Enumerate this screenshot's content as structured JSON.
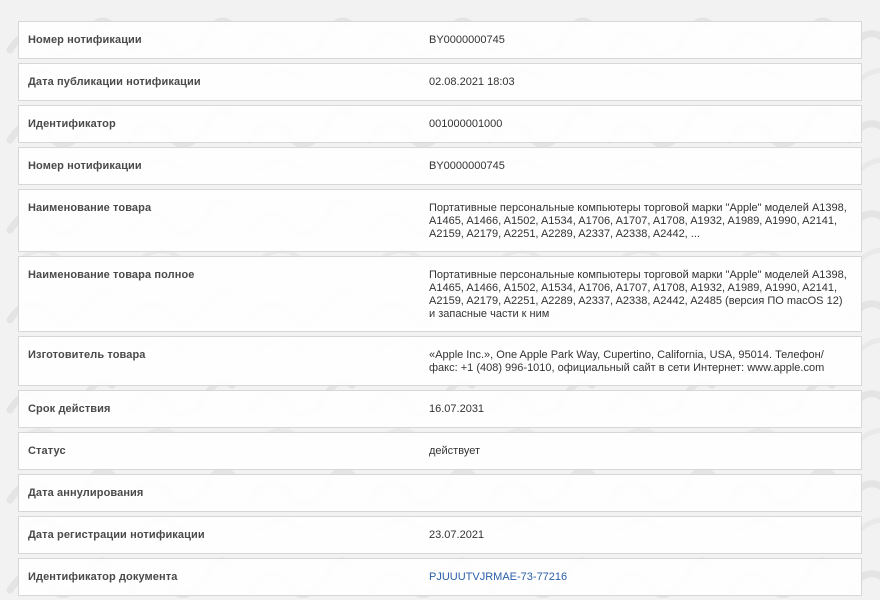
{
  "rows": [
    {
      "label": "Номер нотификации",
      "value": "BY0000000745"
    },
    {
      "label": "Дата публикации нотификации",
      "value": "02.08.2021 18:03"
    },
    {
      "label": "Идентификатор",
      "value": "001000001000"
    },
    {
      "label": "Номер нотификации",
      "value": "BY0000000745"
    },
    {
      "label": "Наименование товара",
      "value": "Портативные персональные компьютеры торговой марки \"Apple\" моделей A1398, A1465, A1466, A1502, A1534, A1706, A1707, A1708, A1932, A1989, A1990, A2141, A2159, A2179, A2251, A2289, A2337, A2338, A2442, ..."
    },
    {
      "label": "Наименование товара полное",
      "value": "Портативные персональные компьютеры торговой марки \"Apple\" моделей A1398, A1465, A1466, A1502, A1534, A1706, A1707, A1708, A1932, A1989, A1990, A2141, A2159, A2179, A2251, A2289, A2337, A2338, A2442, A2485 (версия ПО macOS 12) и запасные части к ним"
    },
    {
      "label": "Изготовитель товара",
      "value": "«Apple Inc.», One Apple Park Way, Cupertino, California, USA, 95014. Телефон/факс: +1 (408) 996-1010, официальный сайт в сети Интернет: www.apple.com"
    },
    {
      "label": "Срок действия",
      "value": "16.07.2031"
    },
    {
      "label": "Статус",
      "value": "действует"
    },
    {
      "label": "Дата аннулирования",
      "value": ""
    },
    {
      "label": "Дата регистрации нотификации",
      "value": "23.07.2021"
    },
    {
      "label": "Идентификатор документа",
      "value": "PJUUUTVJRMAE-73-77216",
      "link": true
    }
  ],
  "colors": {
    "background": "#f2f2f2",
    "row_border": "#d7d7d7",
    "label_text": "#4a4a4a",
    "value_text": "#333333",
    "link_text": "#2a5fa8",
    "watermark": "#e4e4e4"
  },
  "watermark_icon": "checkmark-logo-icon"
}
